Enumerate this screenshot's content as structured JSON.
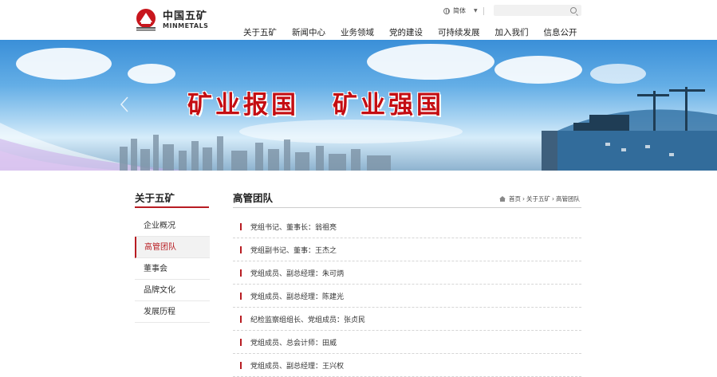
{
  "header": {
    "logo_cn": "中国五矿",
    "logo_en": "MINMETALS",
    "lang_label": "简体",
    "search_placeholder": "",
    "nav": [
      "关于五矿",
      "新闻中心",
      "业务领域",
      "党的建设",
      "可持续发展",
      "加入我们",
      "信息公开"
    ]
  },
  "banner": {
    "slogan_left": "矿业报国",
    "slogan_right": "矿业强国",
    "slide_count": 9,
    "active_slide": 4
  },
  "sidebar": {
    "title": "关于五矿",
    "items": [
      "企业概况",
      "高管团队",
      "董事会",
      "品牌文化",
      "发展历程"
    ],
    "active_index": 1
  },
  "main": {
    "title": "高管团队",
    "breadcrumb": [
      "首页",
      "关于五矿",
      "高管团队"
    ],
    "breadcrumb_sep": "›",
    "items": [
      "党组书记、董事长：翁祖亮",
      "党组副书记、董事：王杰之",
      "党组成员、副总经理：朱可炳",
      "党组成员、副总经理：陈建光",
      "纪检监察组组长、党组成员：张贞民",
      "党组成员、总会计师：田威",
      "党组成员、副总经理：王兴权"
    ]
  },
  "colors": {
    "brand_red": "#b81c22",
    "slogan_red": "#c40d12"
  }
}
